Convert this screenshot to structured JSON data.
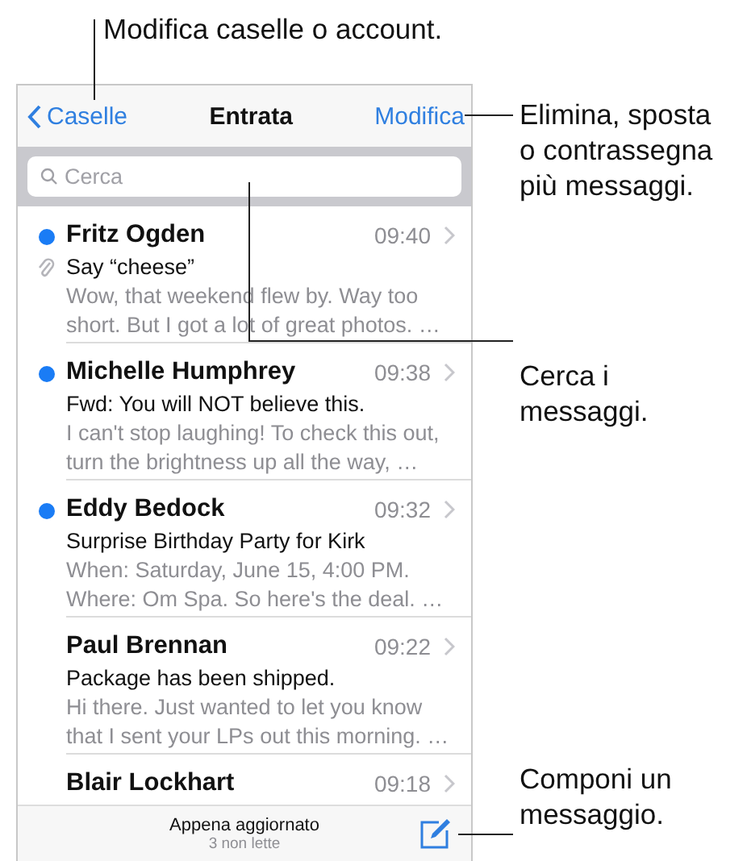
{
  "callouts": [
    {
      "text": "Modifica caselle o account."
    },
    {
      "text": "Elimina, sposta o contrassegna più messaggi."
    },
    {
      "text": "Cerca i messaggi."
    },
    {
      "text": "Componi un messaggio."
    }
  ],
  "nav": {
    "back": "Caselle",
    "title": "Entrata",
    "action": "Modifica"
  },
  "search": {
    "placeholder": "Cerca"
  },
  "messages": [
    {
      "sender": "Fritz Ogden",
      "time": "09:40",
      "unread": true,
      "attachment": true,
      "subject": "Say “cheese”",
      "preview": "Wow, that weekend flew by. Way too short. But I got a lot of great photos. …"
    },
    {
      "sender": "Michelle Humphrey",
      "time": "09:38",
      "unread": true,
      "attachment": false,
      "subject": "Fwd: You will NOT believe this.",
      "preview": "I can't stop laughing! To check this out, turn the brightness up all the way, …"
    },
    {
      "sender": "Eddy Bedock",
      "time": "09:32",
      "unread": true,
      "attachment": false,
      "subject": "Surprise Birthday Party for Kirk",
      "preview": "When: Saturday, June 15, 4:00 PM. Where: Om Spa. So here's the deal. …"
    },
    {
      "sender": "Paul Brennan",
      "time": "09:22",
      "unread": false,
      "attachment": false,
      "subject": "Package has been shipped.",
      "preview": "Hi there. Just wanted to let you know that I sent your LPs out this morning. …"
    },
    {
      "sender": "Blair Lockhart",
      "time": "09:18",
      "unread": false,
      "attachment": false
    }
  ],
  "toolbar": {
    "status": "Appena aggiornato",
    "count": "3 non lette"
  }
}
